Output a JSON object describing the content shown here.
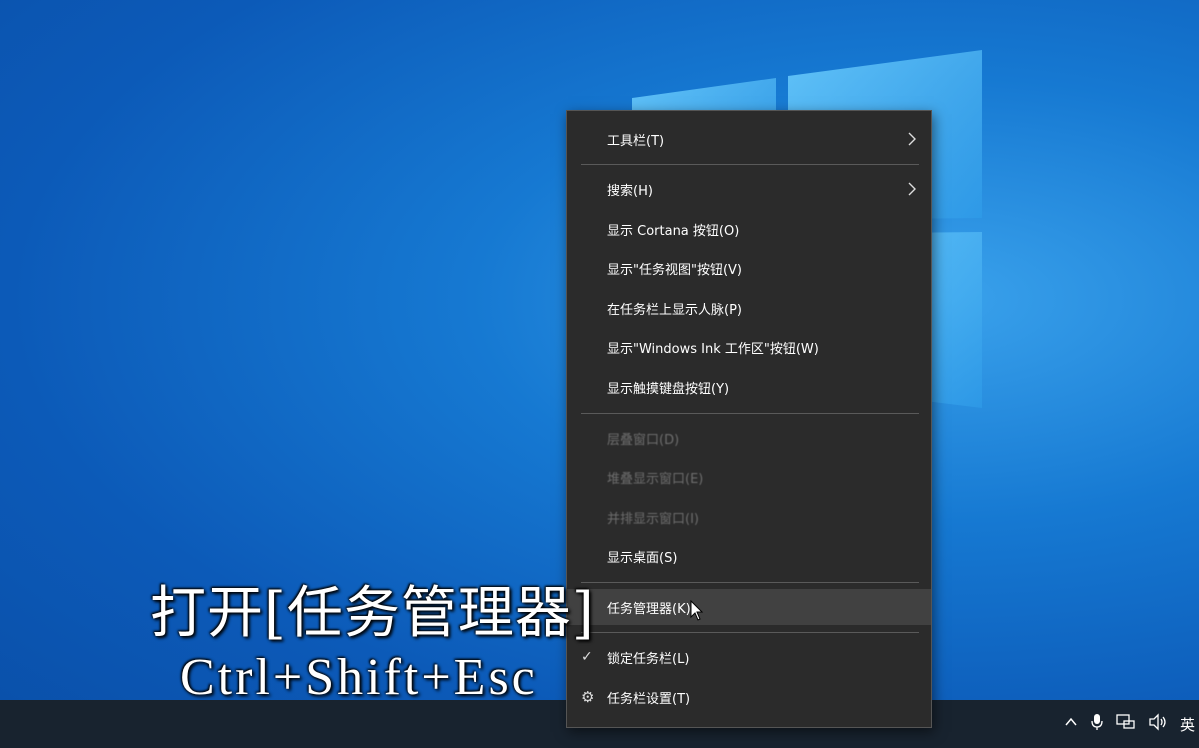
{
  "menu": {
    "items": [
      {
        "label": "工具栏(T)"
      },
      {
        "label": "搜索(H)"
      },
      {
        "label": "显示 Cortana 按钮(O)"
      },
      {
        "label": "显示\"任务视图\"按钮(V)"
      },
      {
        "label": "在任务栏上显示人脉(P)"
      },
      {
        "label": "显示\"Windows Ink 工作区\"按钮(W)"
      },
      {
        "label": "显示触摸键盘按钮(Y)"
      },
      {
        "label": "层叠窗口(D)"
      },
      {
        "label": "堆叠显示窗口(E)"
      },
      {
        "label": "并排显示窗口(I)"
      },
      {
        "label": "显示桌面(S)"
      },
      {
        "label": "任务管理器(K)"
      },
      {
        "label": "锁定任务栏(L)"
      },
      {
        "label": "任务栏设置(T)"
      }
    ]
  },
  "overlay": {
    "title": "打开[任务管理器]",
    "shortcut": "Ctrl+Shift+Esc"
  },
  "tray": {
    "ime": "英"
  },
  "icons": {
    "submenu": "chevron-right-icon",
    "checked": "checkmark-icon",
    "settings": "gear-icon"
  }
}
